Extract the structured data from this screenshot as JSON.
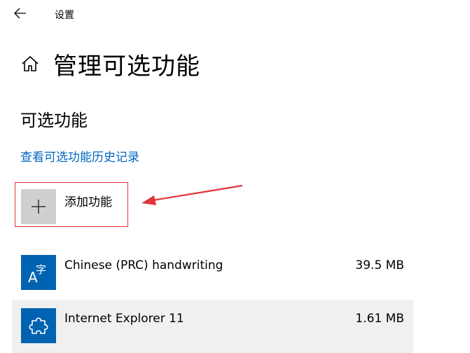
{
  "window": {
    "title": "设置",
    "back_icon": "arrow-left-icon"
  },
  "header": {
    "home_icon": "home-icon",
    "title": "管理可选功能"
  },
  "section": {
    "title": "可选功能",
    "history_link": "查看可选功能历史记录"
  },
  "add_feature": {
    "icon": "plus-icon",
    "label": "添加功能"
  },
  "annotation": {
    "color": "#e0353b"
  },
  "features": [
    {
      "name": "Chinese (PRC) handwriting",
      "size": "39.5 MB",
      "icon": "language-handwriting-icon"
    },
    {
      "name": "Internet Explorer 11",
      "size": "1.61 MB",
      "icon": "puzzle-piece-icon"
    }
  ],
  "colors": {
    "accent": "#0067c0",
    "icon_tile": "#0063b1",
    "add_tile": "#cfcfcf",
    "selected_row": "#f0f0f0"
  }
}
